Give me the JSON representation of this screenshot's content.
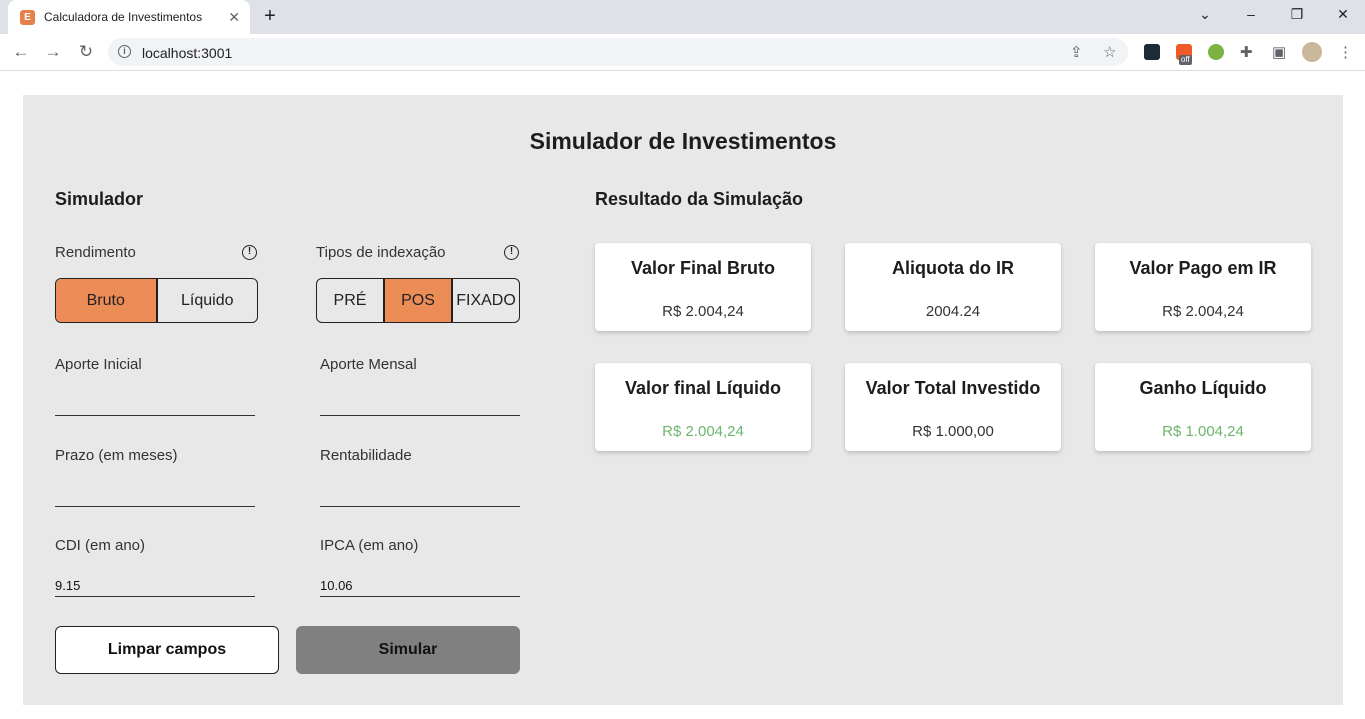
{
  "browser": {
    "tab_title": "Calculadora de Investimentos",
    "favicon_letter": "E",
    "url": "localhost:3001",
    "ext_off_badge": "off"
  },
  "page": {
    "title": "Simulador de Investimentos"
  },
  "simulator": {
    "section_title": "Simulador",
    "rendimento": {
      "label": "Rendimento",
      "options": [
        "Bruto",
        "Líquido"
      ],
      "selected": "Bruto"
    },
    "indexacao": {
      "label": "Tipos de indexação",
      "options": [
        "PRÉ",
        "POS",
        "FIXADO"
      ],
      "selected": "POS"
    },
    "fields": {
      "aporte_inicial": {
        "label": "Aporte Inicial",
        "value": ""
      },
      "aporte_mensal": {
        "label": "Aporte Mensal",
        "value": ""
      },
      "prazo": {
        "label": "Prazo (em meses)",
        "value": ""
      },
      "rentabilidade": {
        "label": "Rentabilidade",
        "value": ""
      },
      "cdi": {
        "label": "CDI (em ano)",
        "value": "9.15"
      },
      "ipca": {
        "label": "IPCA (em ano)",
        "value": "10.06"
      }
    },
    "buttons": {
      "clear": "Limpar campos",
      "simulate": "Simular"
    }
  },
  "results": {
    "section_title": "Resultado da Simulação",
    "cards": [
      {
        "title": "Valor Final Bruto",
        "value": "R$ 2.004,24",
        "positive": false
      },
      {
        "title": "Aliquota do IR",
        "value": "2004.24",
        "positive": false
      },
      {
        "title": "Valor Pago em IR",
        "value": "R$ 2.004,24",
        "positive": false
      },
      {
        "title": "Valor final Líquido",
        "value": "R$ 2.004,24",
        "positive": true
      },
      {
        "title": "Valor Total Investido",
        "value": "R$ 1.000,00",
        "positive": false
      },
      {
        "title": "Ganho Líquido",
        "value": "R$ 1.004,24",
        "positive": true
      }
    ]
  },
  "colors": {
    "accent": "#ec8c57",
    "positive": "#6db56d",
    "panel": "#e8e8e8",
    "button_disabled": "#808080"
  }
}
